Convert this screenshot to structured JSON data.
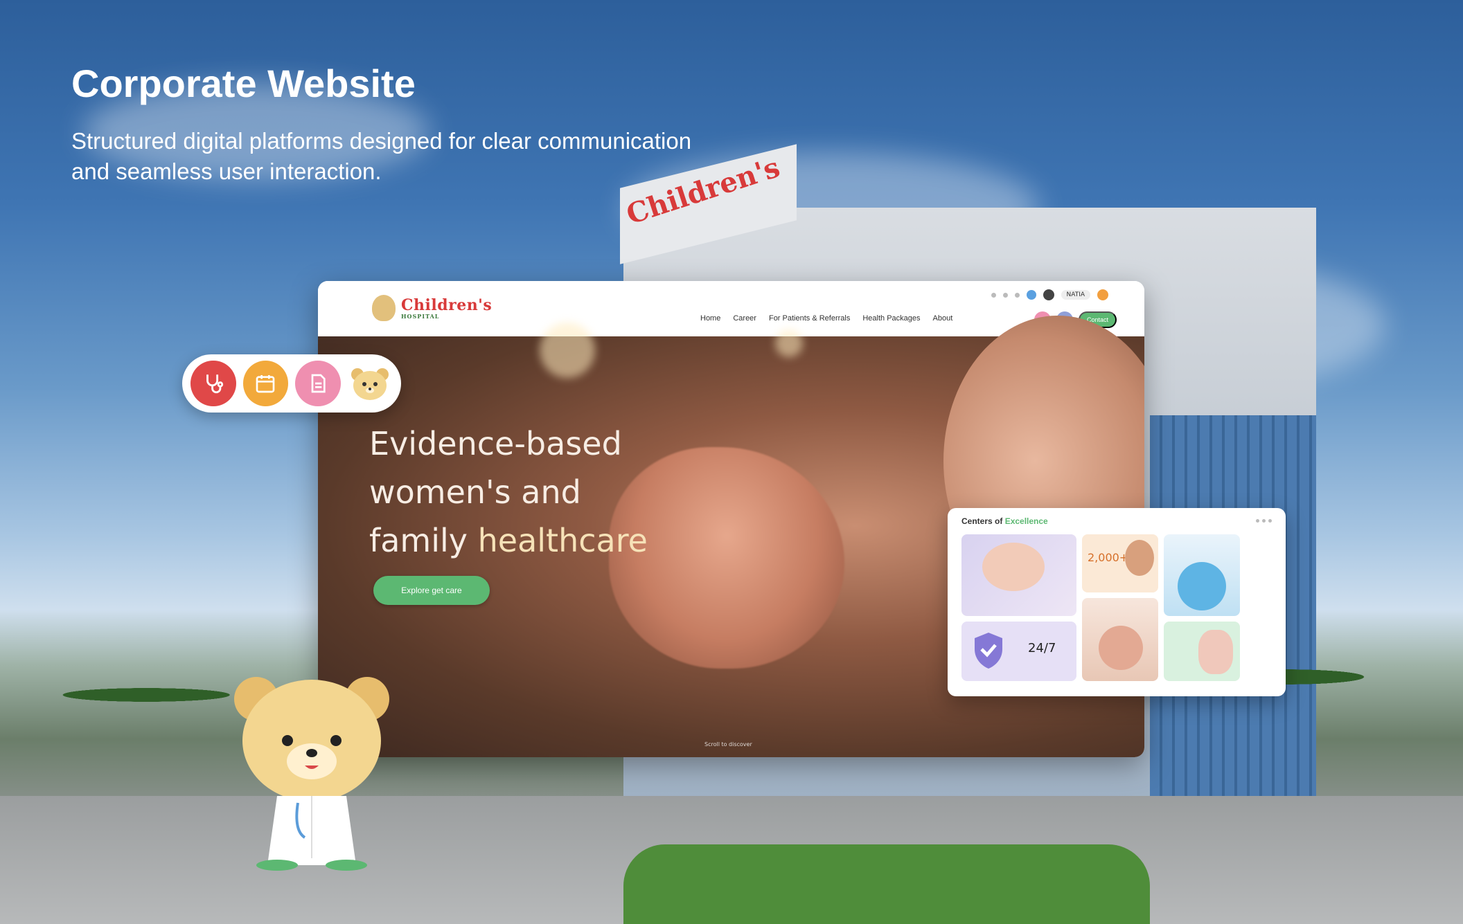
{
  "header": {
    "title": "Corporate Website",
    "subtitle_line1": "Structured digital platforms designed for clear communication",
    "subtitle_line2": "and seamless user interaction."
  },
  "building_sign": {
    "text": "Children's"
  },
  "site": {
    "logo_main": "Children's",
    "logo_sub": "HOSPITAL",
    "nav": [
      "Home",
      "Career",
      "For Patients & Referrals",
      "Health Packages",
      "About"
    ],
    "user_name": "NATIA",
    "contact_label": "Contact"
  },
  "hero": {
    "line1": "Evidence-based",
    "line2": "women's and",
    "line3_plain": "family",
    "line3_highlight": "healthcare",
    "cta_label": "Explore get care",
    "scroll_hint": "Scroll to discover"
  },
  "centers": {
    "title_plain": "Centers of",
    "title_accent": "Excellence",
    "stat_big": "2,000+",
    "stat_247": "24/7"
  },
  "colors": {
    "brand_green": "#5cb872",
    "brand_red": "#d83a3a",
    "pill_red": "#e04848",
    "pill_orange": "#f2a93b",
    "pill_pink": "#ef8fb0",
    "bear_yellow": "#f3d690"
  },
  "pill_icons": [
    "stethoscope-icon",
    "calendar-icon",
    "document-icon",
    "bear-face-icon"
  ]
}
